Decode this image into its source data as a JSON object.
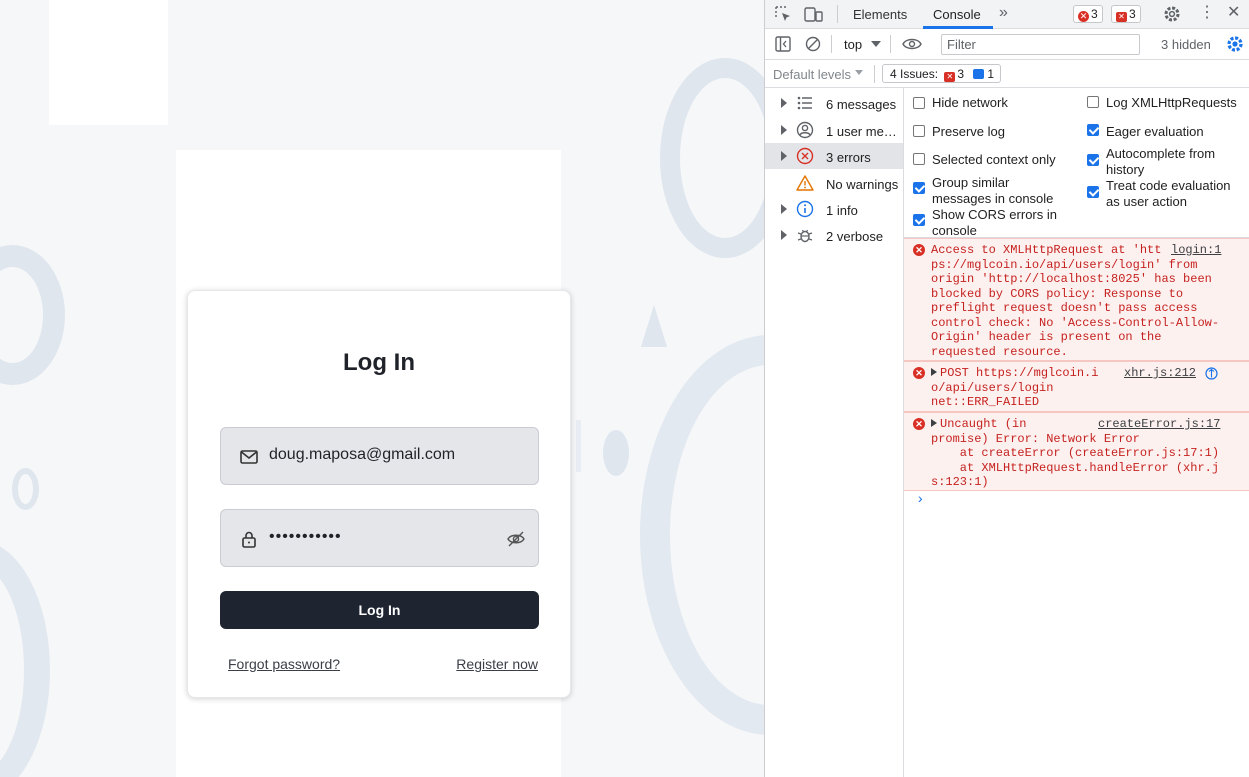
{
  "login": {
    "title": "Log In",
    "email_value": "doug.maposa@gmail.com",
    "password_value": "•••••••••••",
    "submit_label": "Log In",
    "forgot_link": "Forgot password?",
    "register_link": "Register now"
  },
  "devtools": {
    "tabs": [
      {
        "label": "Elements"
      },
      {
        "label": "Console"
      }
    ],
    "error_count": "3",
    "warning_count": "3",
    "context": "top",
    "filter_placeholder": "Filter",
    "hidden_count": "3 hidden",
    "levels": "Default levels",
    "issues_label": "4 Issues:",
    "issues_errors": "3",
    "issues_info": "1",
    "sidebar": [
      {
        "label": "6 messages",
        "icon": "list-icon"
      },
      {
        "label": "1 user me…",
        "icon": "user-icon"
      },
      {
        "label": "3 errors",
        "icon": "error-icon"
      },
      {
        "label": "No warnings",
        "icon": "warning-icon"
      },
      {
        "label": "1 info",
        "icon": "info-icon"
      },
      {
        "label": "2 verbose",
        "icon": "bug-icon"
      }
    ],
    "settings": {
      "hide_network": "Hide network",
      "preserve_log": "Preserve log",
      "selected_context": "Selected context only",
      "group_similar": "Group similar messages in console",
      "show_cors": "Show CORS errors in console",
      "log_xhr": "Log XMLHttpRequests",
      "eager_eval": "Eager evaluation",
      "autocomplete": "Autocomplete from history",
      "treat_code": "Treat code evaluation as user action"
    },
    "messages": [
      {
        "lines": [
          "Access to XMLHttpRequest at 'htt",
          "ps://mglcoin.io/api/users/login' from",
          "origin 'http://localhost:8025' has been",
          "blocked by CORS policy: Response to",
          "preflight request doesn't pass access",
          "control check: No 'Access-Control-Allow-",
          "Origin' header is present on the",
          "requested resource."
        ],
        "source": "login:1"
      },
      {
        "lines": [
          "POST https://mglcoin.i",
          "o/api/users/login",
          "net::ERR_FAILED"
        ],
        "source": "xhr.js:212"
      },
      {
        "lines": [
          "Uncaught (in",
          "promise) Error: Network Error",
          "    at createError (createError.js:17:1)",
          "    at XMLHttpRequest.handleError (xhr.j",
          "s:123:1)"
        ],
        "source": "createError.js:17"
      }
    ],
    "prompt": "›"
  },
  "colors": {
    "accent": "#1a73e8",
    "error": "#d93025",
    "button_dark": "#1e2430"
  }
}
